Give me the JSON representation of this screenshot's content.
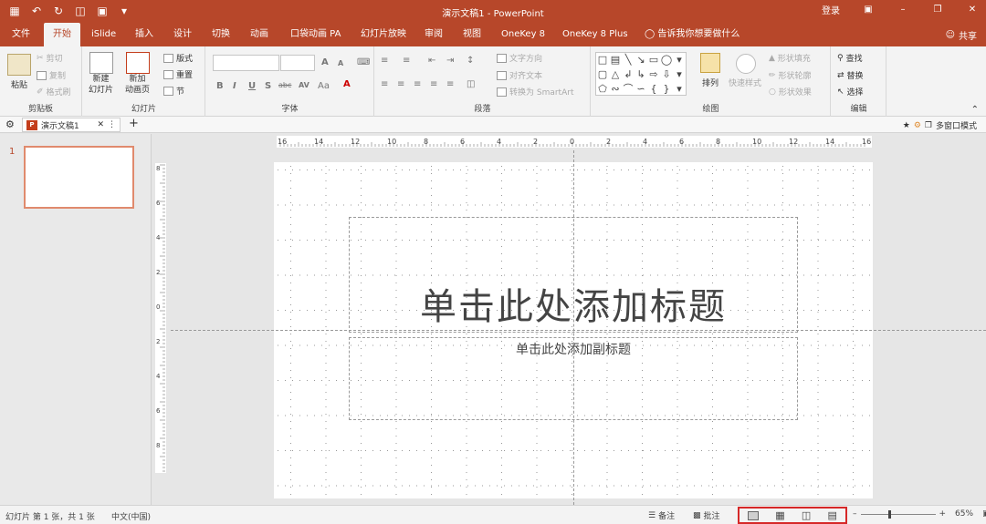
{
  "window": {
    "doc_title": "演示文稿1",
    "app_separator": "-",
    "app_name": "PowerPoint",
    "login": "登录"
  },
  "tabs": [
    {
      "label": "文件"
    },
    {
      "label": "开始"
    },
    {
      "label": "iSlide"
    },
    {
      "label": "插入"
    },
    {
      "label": "设计"
    },
    {
      "label": "切换"
    },
    {
      "label": "动画"
    },
    {
      "label": "口袋动画 PA"
    },
    {
      "label": "幻灯片放映"
    },
    {
      "label": "审阅"
    },
    {
      "label": "视图"
    },
    {
      "label": "OneKey 8"
    },
    {
      "label": "OneKey 8 Plus"
    },
    {
      "label": "告诉我你想要做什么"
    }
  ],
  "share": "共享",
  "ribbon": {
    "clipboard": {
      "paste": "粘贴",
      "cut": "剪切",
      "copy": "复制",
      "format_painter": "格式刷",
      "label": "剪贴板"
    },
    "slides": {
      "new_slide_1": "新建",
      "new_slide_2": "幻灯片",
      "add_slide_1": "新加",
      "add_slide_2": "动画页",
      "layout": "版式",
      "reset": "重置",
      "section": "节",
      "label": "幻灯片"
    },
    "font": {
      "label": "字体",
      "bold": "B",
      "italic": "I",
      "underline": "U",
      "strike": "S",
      "abc": "abc",
      "spacing": "AV",
      "case": "Aa",
      "grow": "A",
      "shrink": "A"
    },
    "paragraph": {
      "text_direction": "文字方向",
      "align_text": "对齐文本",
      "smartart": "转换为 SmartArt",
      "label": "段落"
    },
    "drawing": {
      "arrange": "排列",
      "quick_styles": "快速样式",
      "shape_fill": "形状填充",
      "shape_outline": "形状轮廓",
      "shape_effects": "形状效果",
      "label": "绘图"
    },
    "editing": {
      "find": "查找",
      "replace": "替换",
      "select": "选择",
      "label": "编辑"
    }
  },
  "doc_tab": {
    "name": "演示文稿1",
    "multi_window": "多窗口模式"
  },
  "panel": {
    "slide_number": "1"
  },
  "ruler": {
    "h_labels": [
      "16",
      "14",
      "12",
      "10",
      "8",
      "6",
      "4",
      "2",
      "0",
      "2",
      "4",
      "6",
      "8",
      "10",
      "12",
      "14",
      "16"
    ],
    "v_labels": [
      "8",
      "6",
      "4",
      "2",
      "0",
      "2",
      "4",
      "6",
      "8"
    ]
  },
  "slide": {
    "title_placeholder": "单击此处添加标题",
    "subtitle_placeholder": "单击此处添加副标题"
  },
  "status": {
    "slide_info": "幻灯片 第 1 张，共 1 张",
    "language": "中文(中国)",
    "notes": "备注",
    "comments": "批注",
    "zoom": "65%"
  }
}
